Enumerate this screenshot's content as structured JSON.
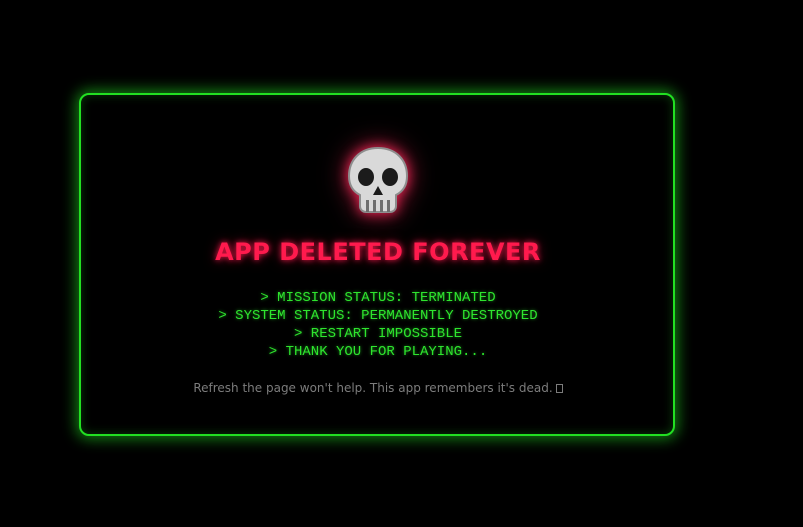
{
  "screen": {
    "title": "APP DELETED FOREVER",
    "icon": "skull-icon",
    "status_lines": [
      "> MISSION STATUS: TERMINATED",
      "> SYSTEM STATUS: PERMANENTLY DESTROYED",
      "> RESTART IMPOSSIBLE",
      "> THANK YOU FOR PLAYING..."
    ],
    "note": "Refresh the page won't help. This app remembers it's dead."
  },
  "colors": {
    "background": "#000000",
    "panel_border": "#22e022",
    "title": "#ff1a4d",
    "status_text": "#2ee52e",
    "note_text": "#7c7c7c"
  }
}
